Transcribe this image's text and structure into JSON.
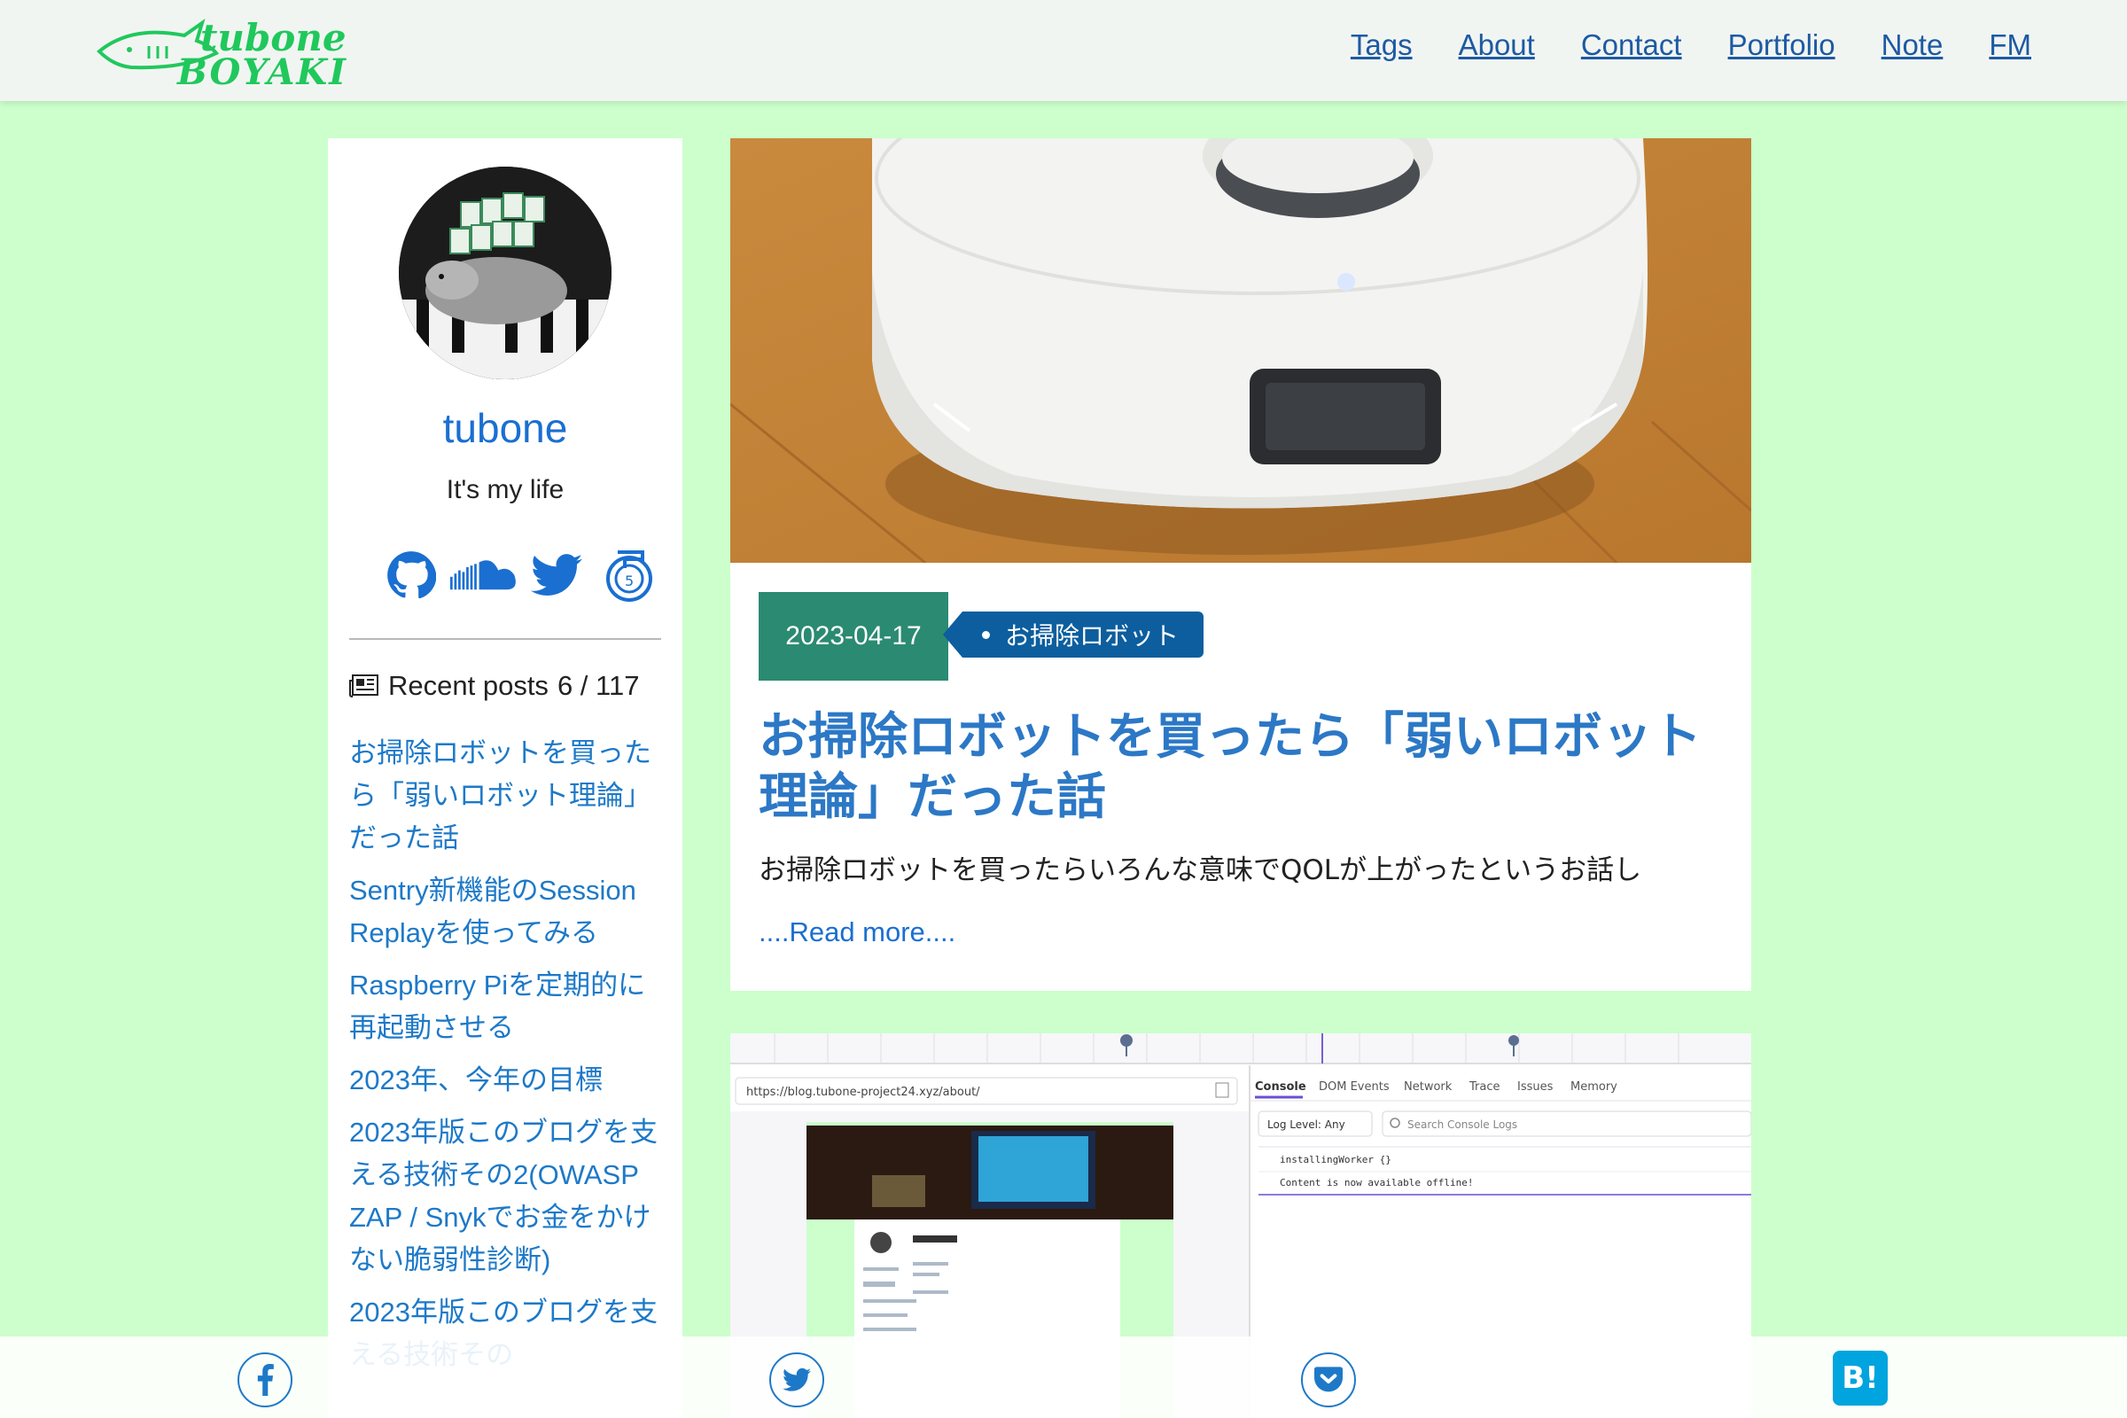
{
  "header": {
    "logo_line1": "tubone",
    "logo_line2": "BOYAKI",
    "nav": [
      "Tags",
      "About",
      "Contact",
      "Portfolio",
      "Note",
      "FM"
    ]
  },
  "sidebar": {
    "name": "tubone",
    "bio": "It's my life",
    "social_icons": [
      "github-icon",
      "soundcloud-icon",
      "twitter-icon",
      "note-icon"
    ],
    "recent_label": "Recent posts",
    "recent_count": "6 / 117",
    "recent_posts": [
      "お掃除ロボットを買ったら「弱いロボット理論」だった話",
      "Sentry新機能のSession Replayを使ってみる",
      "Raspberry Piを定期的に再起動させる",
      "2023年、今年の目標",
      "2023年版このブログを支える技術その2(OWASP ZAP / Snykでお金をかけない脆弱性診断)",
      "2023年版このブログを支える技術その"
    ]
  },
  "post": {
    "date": "2023-04-17",
    "tag": "お掃除ロボット",
    "title": "お掃除ロボットを買ったら「弱いロボット理論」だった話",
    "description": "お掃除ロボットを買ったらいろんな意味でQOLが上がったというお話し",
    "read_more": "....Read more...."
  },
  "post2_image": {
    "url": "https://blog.tubone-project24.xyz/about/",
    "tabs": [
      "Console",
      "DOM Events",
      "Network",
      "Trace",
      "Issues",
      "Memory"
    ],
    "log_level": "Log Level: Any",
    "search_placeholder": "Search Console Logs",
    "console_lines": [
      "installingWorker {}",
      "Content is now available offline!"
    ]
  },
  "share": [
    "facebook-icon",
    "twitter-icon",
    "pocket-icon",
    "hatena-bookmark-icon"
  ],
  "colors": {
    "background": "#ccffcc",
    "accent_blue": "#1d79c8",
    "date_badge": "#2b8a72",
    "tag_bg": "#0c5e9e",
    "logo_green": "#20c85c"
  }
}
